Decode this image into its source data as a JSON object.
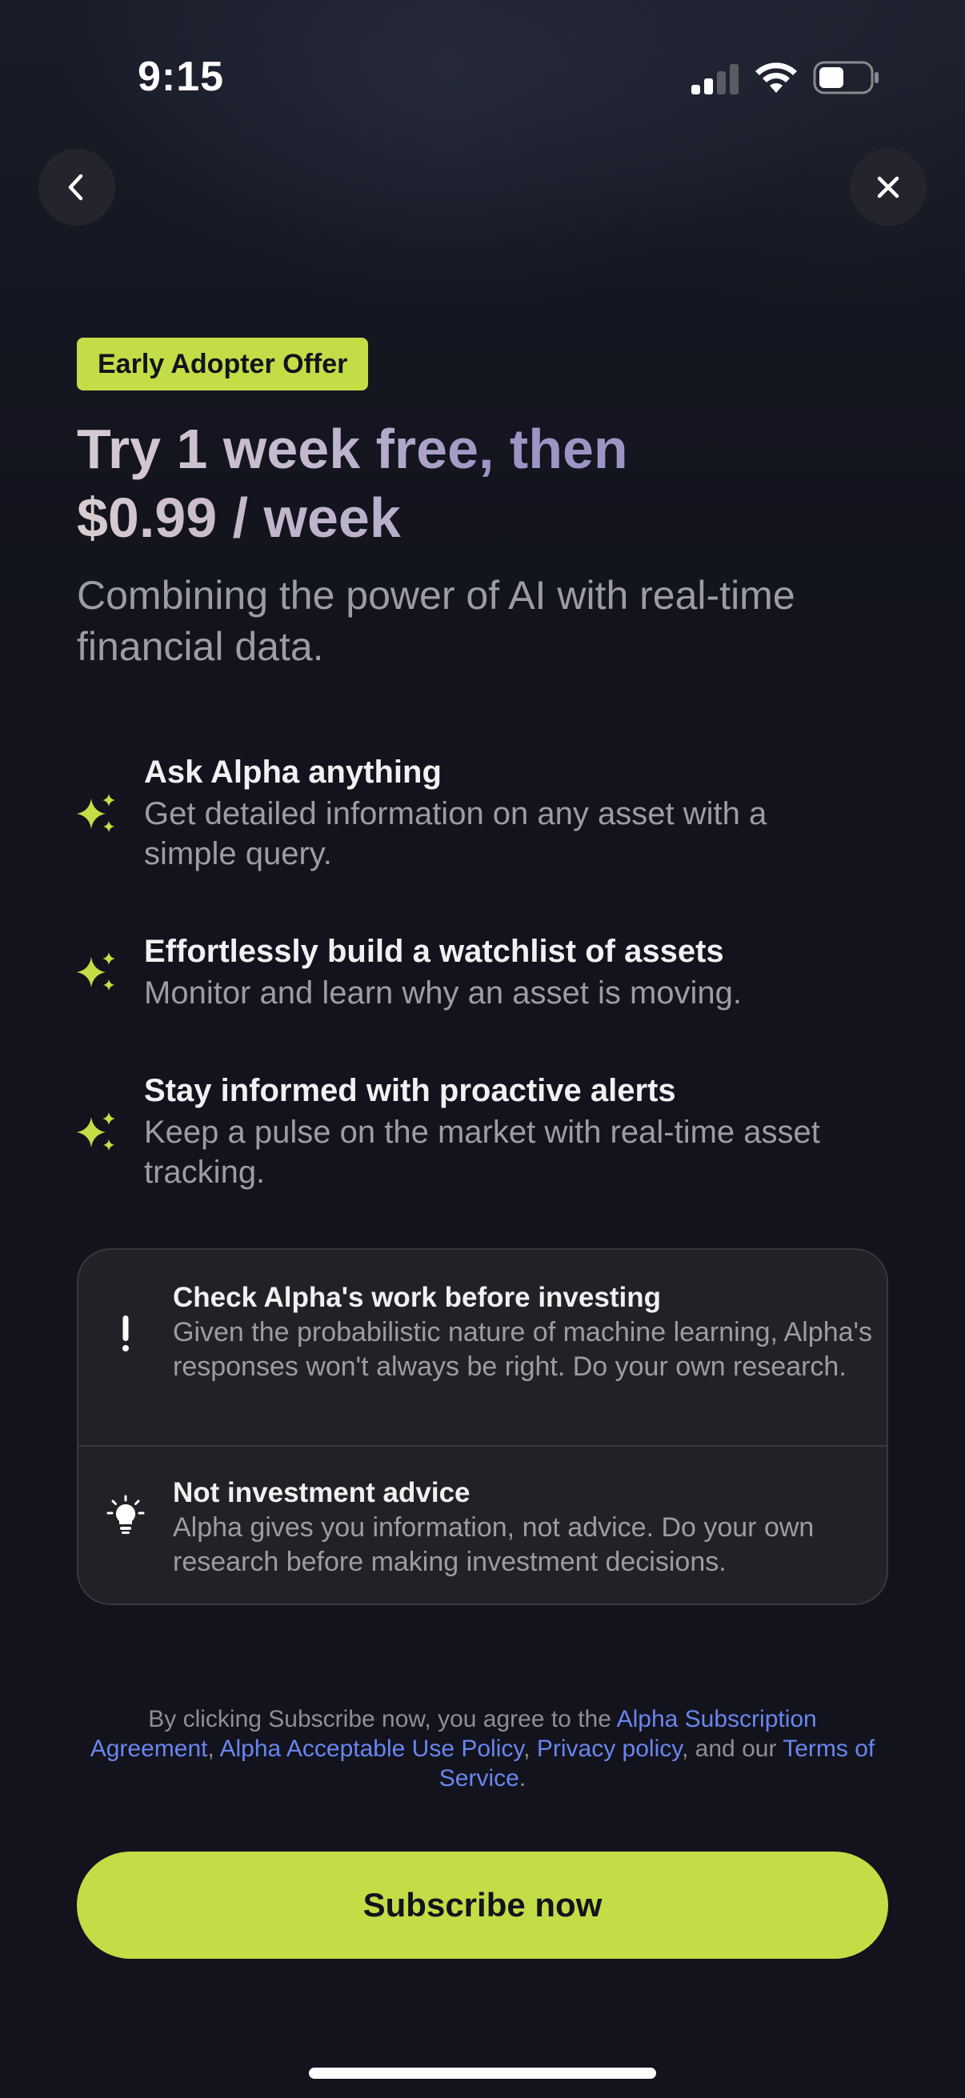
{
  "status_bar": {
    "time": "9:15"
  },
  "nav": {
    "back_icon": "chevron-left-icon",
    "close_icon": "close-icon"
  },
  "offer": {
    "badge": "Early Adopter Offer",
    "headline_line1": "Try 1 week free, then",
    "headline_line2": "$0.99 / week",
    "subheadline": "Combining the power of AI with real-time financial data."
  },
  "features": [
    {
      "icon": "sparkles-icon",
      "title": "Ask Alpha anything",
      "description": "Get detailed information on any asset with a simple query."
    },
    {
      "icon": "sparkles-icon",
      "title": "Effortlessly build a watchlist of assets",
      "description": "Monitor and learn why an asset is moving."
    },
    {
      "icon": "sparkles-icon",
      "title": "Stay informed with proactive alerts",
      "description": "Keep a pulse on the market with real-time asset tracking."
    }
  ],
  "notices": [
    {
      "icon": "exclamation-icon",
      "title": "Check Alpha's work before investing",
      "description": "Given the probabilistic nature of machine learning, Alpha's responses won't always be right. Do your own research."
    },
    {
      "icon": "lightbulb-icon",
      "title": "Not investment advice",
      "description": "Alpha gives you information, not advice. Do your own research before making investment decisions."
    }
  ],
  "legal": {
    "prefix": "By clicking Subscribe now, you agree to the ",
    "link_subscription": "Alpha Subscription Agreement",
    "sep1": ", ",
    "link_aup": "Alpha Acceptable Use Policy",
    "sep2": ", ",
    "link_privacy": "Privacy policy",
    "sep3": ", and our ",
    "link_tos": "Terms of Service",
    "suffix": "."
  },
  "cta": {
    "subscribe_label": "Subscribe now"
  },
  "colors": {
    "accent": "#c3dd47",
    "background": "#12131d",
    "link": "#6a86ee",
    "muted_text": "#9c9ca3"
  }
}
